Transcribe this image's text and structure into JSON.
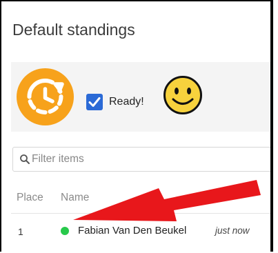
{
  "page": {
    "title": "Default standings"
  },
  "status": {
    "ready_label": "Ready!",
    "ready_checked": true,
    "timer_icon": "clock-refresh-icon",
    "mood_icon": "smiley-icon"
  },
  "filter": {
    "placeholder": "Filter items",
    "value": ""
  },
  "table": {
    "columns": [
      "Place",
      "Name"
    ],
    "rows": [
      {
        "place": "1",
        "name": "Fabian Van Den Beukel",
        "time": "just now",
        "online": true
      }
    ]
  },
  "colors": {
    "accent_orange": "#f7a21b",
    "checkbox_blue": "#2b6ad6",
    "online_green": "#28c94b",
    "annotation_red": "#e8171b",
    "smiley_yellow": "#f7d23d"
  }
}
